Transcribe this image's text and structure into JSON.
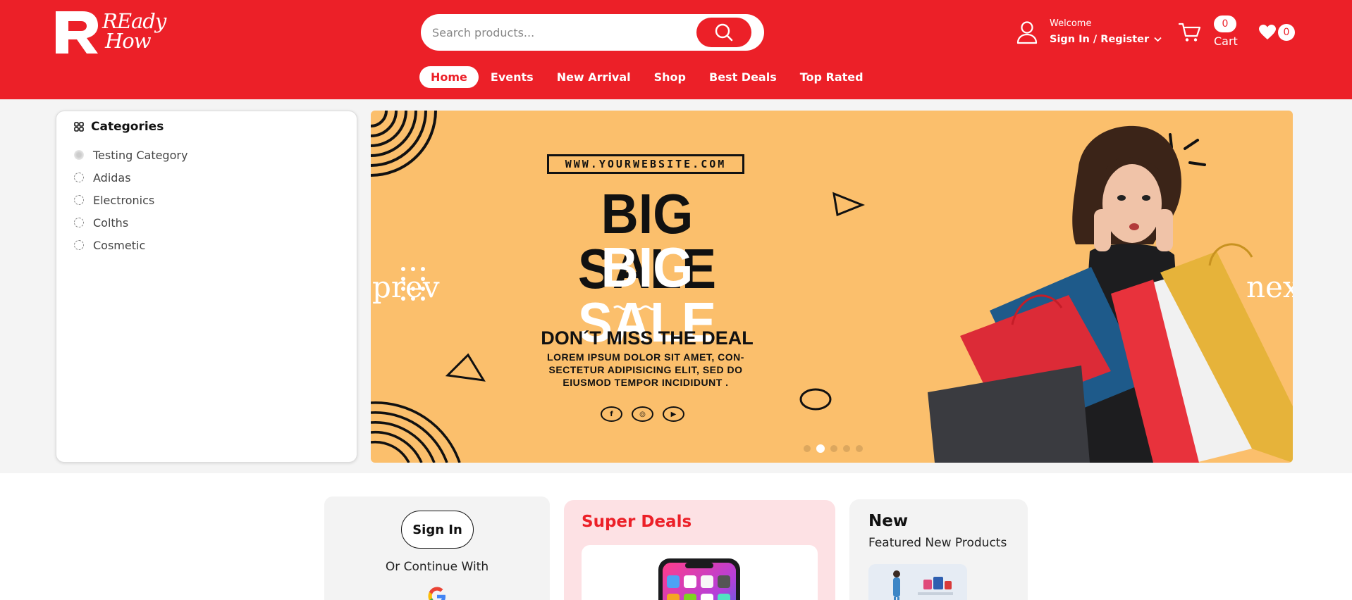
{
  "brand": {
    "logo_line1": "REady",
    "logo_line2": "How",
    "colors": {
      "primary": "#ec2028",
      "banner": "#fbbf6c",
      "deals_bg": "#fde1e4"
    }
  },
  "search": {
    "placeholder": "Search products...",
    "icon": "search-icon"
  },
  "account": {
    "welcome": "Welcome",
    "signin_label": "Sign In / Register",
    "icon": "user-icon"
  },
  "cart": {
    "count": "0",
    "label": "Cart",
    "icon": "cart-icon"
  },
  "wishlist": {
    "count": "0",
    "icon": "heart-icon"
  },
  "nav": [
    {
      "label": "Home",
      "active": true
    },
    {
      "label": "Events"
    },
    {
      "label": "New Arrival"
    },
    {
      "label": "Shop"
    },
    {
      "label": "Best Deals"
    },
    {
      "label": "Top Rated"
    }
  ],
  "categories": {
    "title": "Categories",
    "items": [
      "Testing Category",
      "Adidas",
      "Electronics",
      "Colths",
      "Cosmetic"
    ]
  },
  "banner": {
    "website": "WWW.YOURWEBSITE.COM",
    "headline1": "BIG SALE",
    "headline2": "BIG SALE",
    "tagline": "DON´T MISS THE DEAL",
    "body_line1": "LOREM IPSUM DOLOR SIT AMET, CON-",
    "body_line2": "SECTETUR ADIPISICING ELIT, SED DO",
    "body_line3": "EIUSMOD TEMPOR INCIDIDUNT .",
    "prev_label": "prev",
    "next_label": "next",
    "slide_count": 5,
    "active_slide": 2
  },
  "signin_card": {
    "button": "Sign In",
    "continue_text": "Or Continue With",
    "icon": "google-icon"
  },
  "deals_card": {
    "title": "Super Deals"
  },
  "new_card": {
    "title": "New",
    "subtitle": "Featured New Products"
  }
}
